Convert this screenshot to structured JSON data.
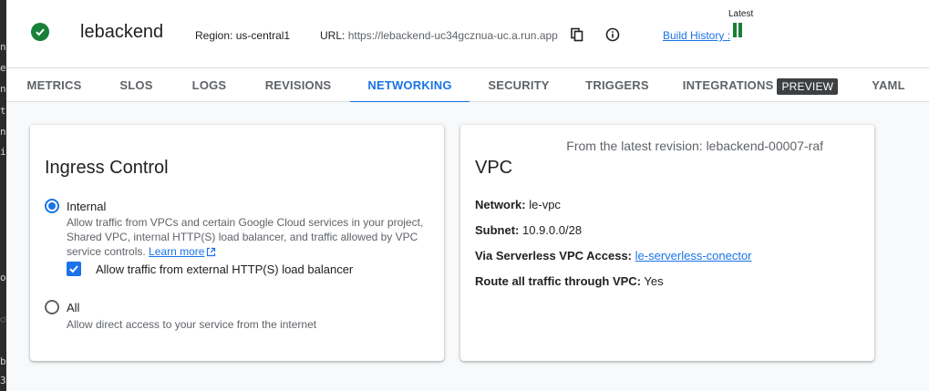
{
  "side_fragments": [
    "n",
    "e",
    "n",
    "t\\",
    "n",
    "ic",
    "oj",
    "ा",
    "b",
    "3"
  ],
  "header": {
    "status": "success",
    "service_name": "lebackend",
    "region_label": "Region:",
    "region_value": "us-central1",
    "url_label": "URL:",
    "url_value": "https://lebackend-uc34gcznua-uc.a.run.app",
    "build_history_label": "Build History",
    "build_history_suffix": ":",
    "latest_label": "Latest",
    "icons": [
      "check-circle-icon",
      "copy-icon",
      "info-icon",
      "build-status-icon"
    ]
  },
  "tabs": [
    {
      "label": "METRICS",
      "active": false
    },
    {
      "label": "SLOS",
      "active": false
    },
    {
      "label": "LOGS",
      "active": false
    },
    {
      "label": "REVISIONS",
      "active": false
    },
    {
      "label": "NETWORKING",
      "active": true
    },
    {
      "label": "SECURITY",
      "active": false
    },
    {
      "label": "TRIGGERS",
      "active": false
    },
    {
      "label": "INTEGRATIONS",
      "active": false,
      "badge": "PREVIEW"
    },
    {
      "label": "YAML",
      "active": false
    }
  ],
  "ingress": {
    "title": "Ingress Control",
    "internal": {
      "label": "Internal",
      "selected": true,
      "desc_line1": "Allow traffic from VPCs and certain Google Cloud services in your project,",
      "desc_line2": "Shared VPC, internal HTTP(S) load balancer, and traffic allowed by VPC",
      "desc_line3": "service controls.",
      "learn_more": "Learn more"
    },
    "external_lb": {
      "label": "Allow traffic from external HTTP(S) load balancer",
      "checked": true
    },
    "all": {
      "label": "All",
      "selected": false,
      "desc": "Allow direct access to your service from the internet"
    }
  },
  "vpc": {
    "note": "From the latest revision: lebackend-00007-raf",
    "title": "VPC",
    "network_label": "Network:",
    "network_value": "le-vpc",
    "subnet_label": "Subnet:",
    "subnet_value": "10.9.0.0/28",
    "access_label": "Via Serverless VPC Access:",
    "access_value": "le-serverless-conector",
    "route_label": "Route all traffic through VPC:",
    "route_value": "Yes"
  },
  "colors": {
    "accent": "#1a73e8",
    "success": "#188038",
    "badge_bg": "#3c4043"
  }
}
